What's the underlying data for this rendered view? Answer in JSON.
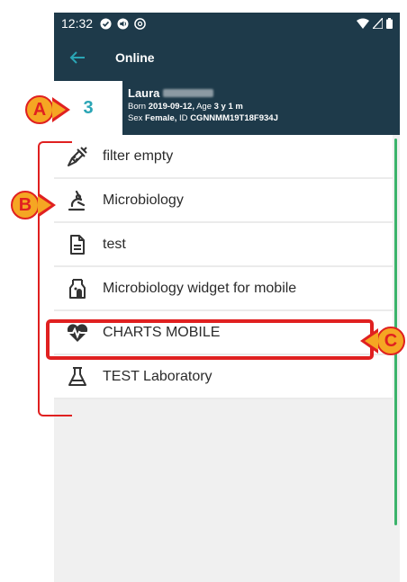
{
  "status_bar": {
    "time": "12:32"
  },
  "app_bar": {
    "title": "Online"
  },
  "patient": {
    "bed": "3",
    "name": "Laura",
    "born_label": "Born",
    "born": "2019-09-12,",
    "age_label": "Age",
    "age": "3 y 1 m",
    "sex_label": "Sex",
    "sex": "Female,",
    "id_label": "ID",
    "id": "CGNNMM19T18F934J"
  },
  "menu": {
    "items": [
      {
        "label": "filter empty",
        "icon": "syringe-icon"
      },
      {
        "label": "Microbiology",
        "icon": "microscope-icon"
      },
      {
        "label": "test",
        "icon": "document-icon"
      },
      {
        "label": "Microbiology widget for mobile",
        "icon": "culture-bottle-icon"
      },
      {
        "label": "CHARTS MOBILE",
        "icon": "heartbeat-icon"
      },
      {
        "label": "TEST Laboratory",
        "icon": "flask-icon"
      }
    ]
  },
  "callouts": {
    "a": "A",
    "b": "B",
    "c": "C"
  },
  "colors": {
    "header": "#1e3a4a",
    "accent": "#2aa5b5",
    "annotation": "#e02020",
    "callout_fill": "#f5a623",
    "scroll": "#3bb36b"
  }
}
